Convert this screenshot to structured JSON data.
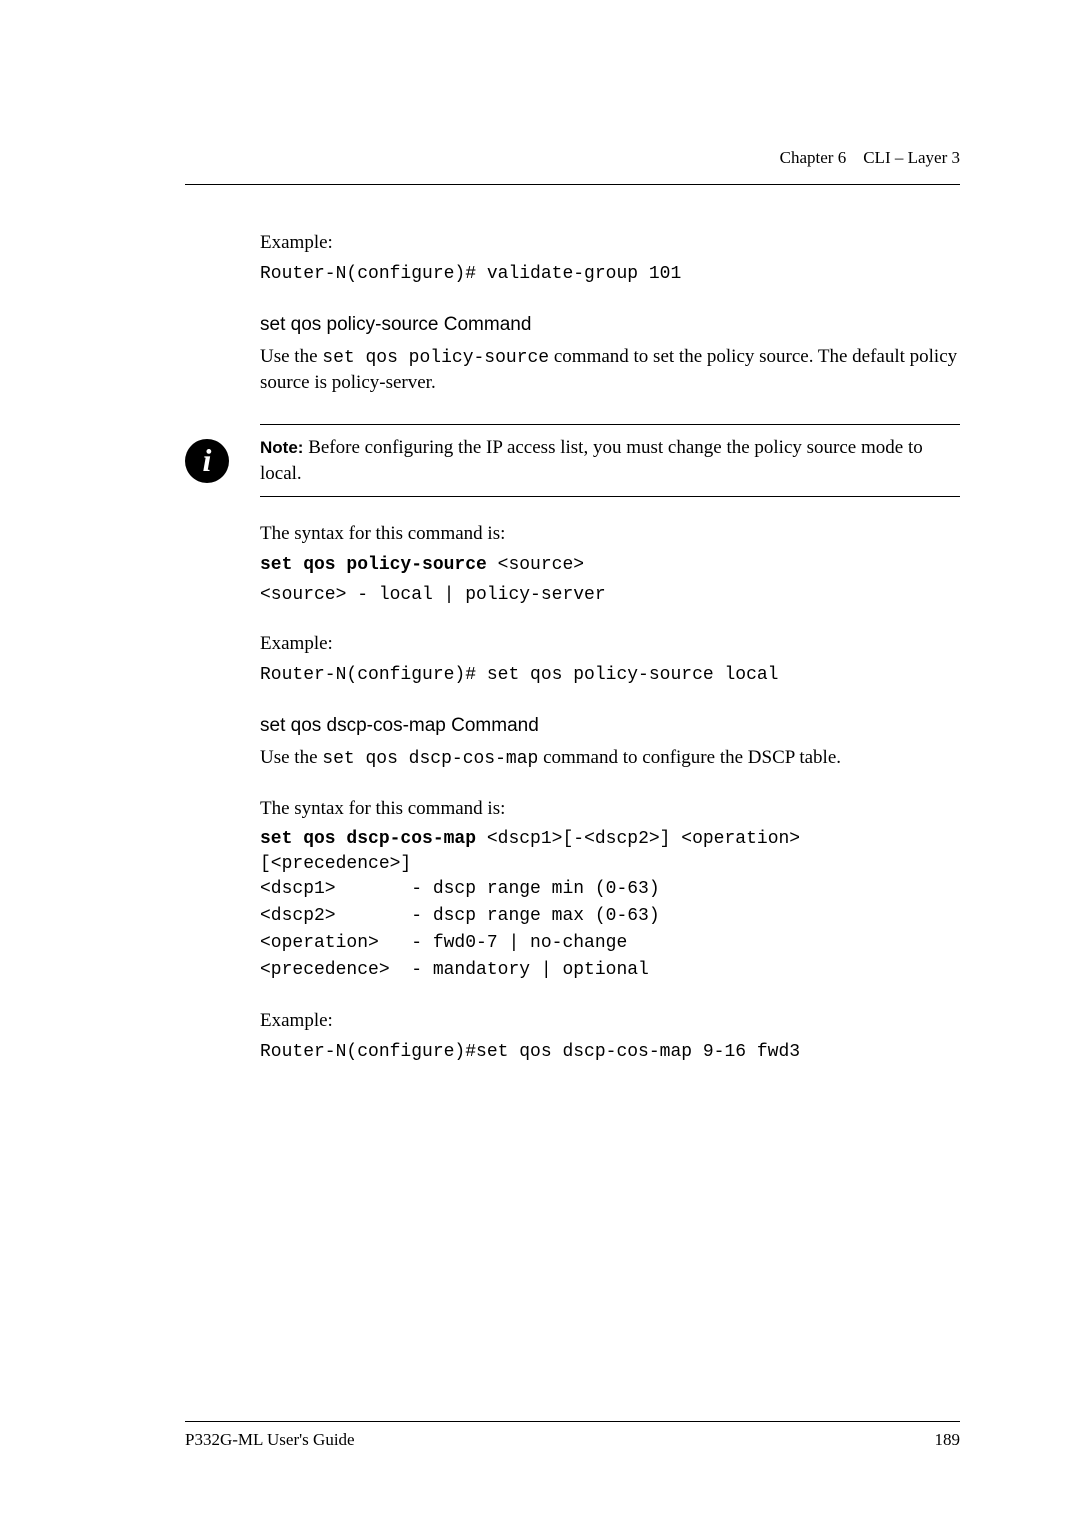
{
  "header": {
    "chapter": "Chapter 6",
    "title": "CLI – Layer 3"
  },
  "section1": {
    "example_label": "Example:",
    "example_code": "Router-N(configure)# validate-group 101"
  },
  "section2": {
    "heading": "set qos policy-source Command",
    "intro_pre": "Use the ",
    "intro_code": "set qos policy-source",
    "intro_post": " command to set the policy source. The default policy source is policy-server.",
    "note_label": "Note:",
    "note_text": "  Before configuring the IP access list, you must change the policy source mode to local.",
    "syntax_intro": "The syntax for this command is:",
    "syntax_cmd_bold": "set qos policy-source",
    "syntax_cmd_rest": " <source>",
    "syntax_param": "<source>  - local | policy-server",
    "example_label": "Example:",
    "example_code": "Router-N(configure)# set qos policy-source local"
  },
  "section3": {
    "heading": "set qos dscp-cos-map Command",
    "intro_pre": "Use the ",
    "intro_code": "set qos dscp-cos-map",
    "intro_post": " command to configure the DSCP table.",
    "syntax_intro": "The syntax for this command is:",
    "syntax_cmd_bold": "set qos dscp-cos-map",
    "syntax_cmd_rest": " <dscp1>[-<dscp2>] <operation> [<precedence>]",
    "param1": "<dscp1>       - dscp range min (0-63)",
    "param2": "<dscp2>       - dscp range max (0-63)",
    "param3": "<operation>   - fwd0-7 | no-change",
    "param4": "<precedence>  - mandatory | optional",
    "example_label": "Example:",
    "example_code": "Router-N(configure)#set qos dscp-cos-map 9-16 fwd3"
  },
  "footer": {
    "guide": "P332G-ML User's Guide",
    "page": "189"
  }
}
